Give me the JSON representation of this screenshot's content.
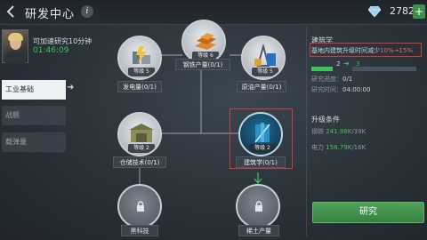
{
  "header": {
    "title": "研发中心",
    "info_symbol": "i",
    "gems": "2782",
    "add_symbol": "+"
  },
  "accelerate": {
    "text": "可加速研究10分钟",
    "time": "01:46:09"
  },
  "categories": [
    {
      "label": "工业基础",
      "active": true
    },
    {
      "label": "战舰",
      "active": false
    },
    {
      "label": "载弹量",
      "active": false
    }
  ],
  "nodes": [
    {
      "id": "steel",
      "label": "钢铁产量(0/1)",
      "level": "等级 6",
      "locked": false
    },
    {
      "id": "power",
      "label": "发电量(0/1)",
      "level": "等级 5",
      "locked": false
    },
    {
      "id": "oil",
      "label": "原油产量(0/1)",
      "level": "等级 5",
      "locked": false
    },
    {
      "id": "storage",
      "label": "仓储技术(0/1)",
      "level": "等级 2",
      "locked": false
    },
    {
      "id": "construction",
      "label": "建筑学(0/1)",
      "level": "等级 2",
      "locked": false
    },
    {
      "id": "blacktech",
      "label": "黑科技",
      "level": "",
      "locked": true
    },
    {
      "id": "rareearth",
      "label": "稀土产量",
      "level": "",
      "locked": true
    }
  ],
  "detail": {
    "title": "建筑学",
    "effect_prefix": "基地内建筑升级时间减少",
    "effect_values": "10%→15%",
    "level_from": "2",
    "level_to": "3",
    "progress_label": "研究进度：",
    "progress_value": "0/1",
    "time_label": "研究时间：",
    "time_value": "04:00:00",
    "upgrade_title": "升级条件",
    "requirements": [
      {
        "label": "钢铁",
        "have": "241.98",
        "need": "K/39K"
      },
      {
        "label": "电力",
        "have": "158.79",
        "need": "K/16K"
      }
    ],
    "research_button": "研究"
  },
  "colors": {
    "accent_green": "#39c35a",
    "highlight_red": "#d23b3b",
    "button_green": "#4fa35a"
  }
}
